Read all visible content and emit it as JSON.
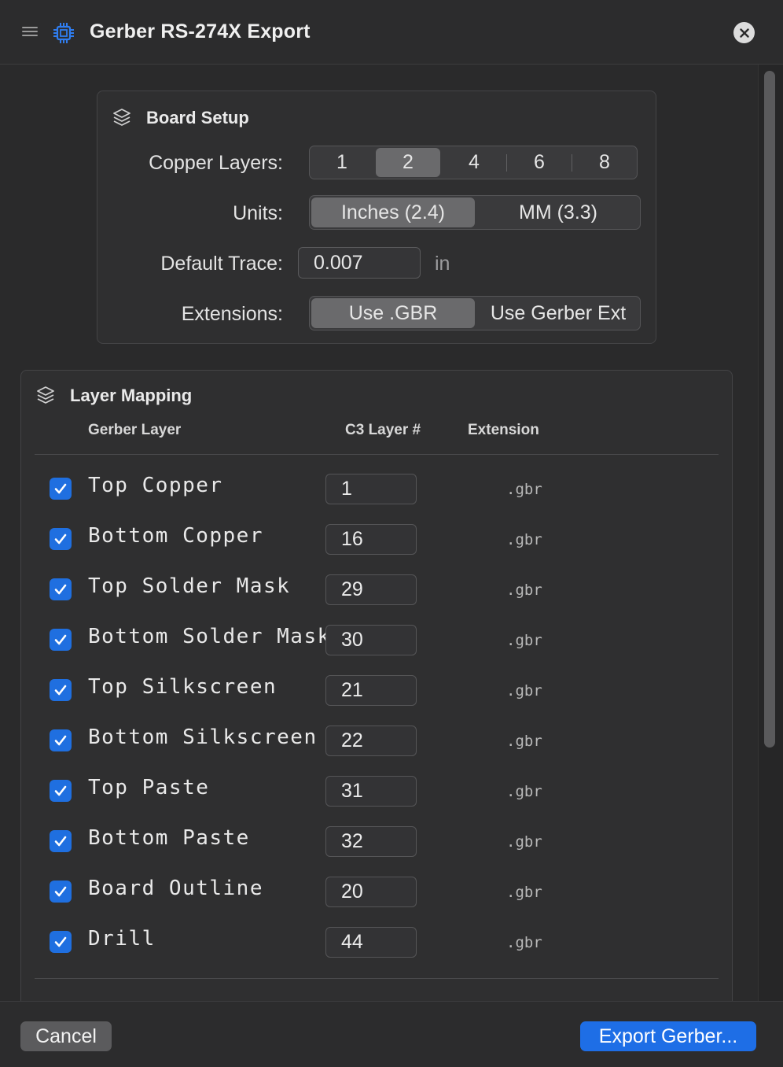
{
  "window": {
    "title": "Gerber RS-274X Export"
  },
  "board_setup": {
    "title": "Board Setup",
    "copper_layers": {
      "label": "Copper Layers:",
      "options": [
        "1",
        "2",
        "4",
        "6",
        "8"
      ],
      "selected": "2"
    },
    "units": {
      "label": "Units:",
      "options": [
        "Inches (2.4)",
        "MM (3.3)"
      ],
      "selected": "Inches (2.4)"
    },
    "default_trace": {
      "label": "Default Trace:",
      "value": "0.007",
      "unit": "in"
    },
    "extensions": {
      "label": "Extensions:",
      "options": [
        "Use .GBR",
        "Use Gerber Ext"
      ],
      "selected": "Use .GBR"
    }
  },
  "layer_mapping": {
    "title": "Layer Mapping",
    "columns": [
      "Gerber Layer",
      "C3 Layer #",
      "Extension"
    ],
    "rows": [
      {
        "name": "Top Copper",
        "layer": "1",
        "ext": ".gbr",
        "checked": true
      },
      {
        "name": "Bottom Copper",
        "layer": "16",
        "ext": ".gbr",
        "checked": true
      },
      {
        "name": "Top Solder Mask",
        "layer": "29",
        "ext": ".gbr",
        "checked": true
      },
      {
        "name": "Bottom Solder Mask",
        "layer": "30",
        "ext": ".gbr",
        "checked": true
      },
      {
        "name": "Top Silkscreen",
        "layer": "21",
        "ext": ".gbr",
        "checked": true
      },
      {
        "name": "Bottom Silkscreen",
        "layer": "22",
        "ext": ".gbr",
        "checked": true
      },
      {
        "name": "Top Paste",
        "layer": "31",
        "ext": ".gbr",
        "checked": true
      },
      {
        "name": "Bottom Paste",
        "layer": "32",
        "ext": ".gbr",
        "checked": true
      },
      {
        "name": "Board Outline",
        "layer": "20",
        "ext": ".gbr",
        "checked": true
      },
      {
        "name": "Drill",
        "layer": "44",
        "ext": ".gbr",
        "checked": true
      }
    ]
  },
  "footer": {
    "cancel_label": "Cancel",
    "export_label": "Export Gerber..."
  },
  "colors": {
    "accent": "#1e6ee6",
    "checkbox": "#1f6fe0",
    "background": "#2a2a2b",
    "card": "#2f2f30"
  },
  "icons": {
    "menu": "hamburger-icon",
    "app": "chip-icon",
    "close": "close-icon",
    "section": "layers-icon",
    "check": "checkmark-icon"
  }
}
